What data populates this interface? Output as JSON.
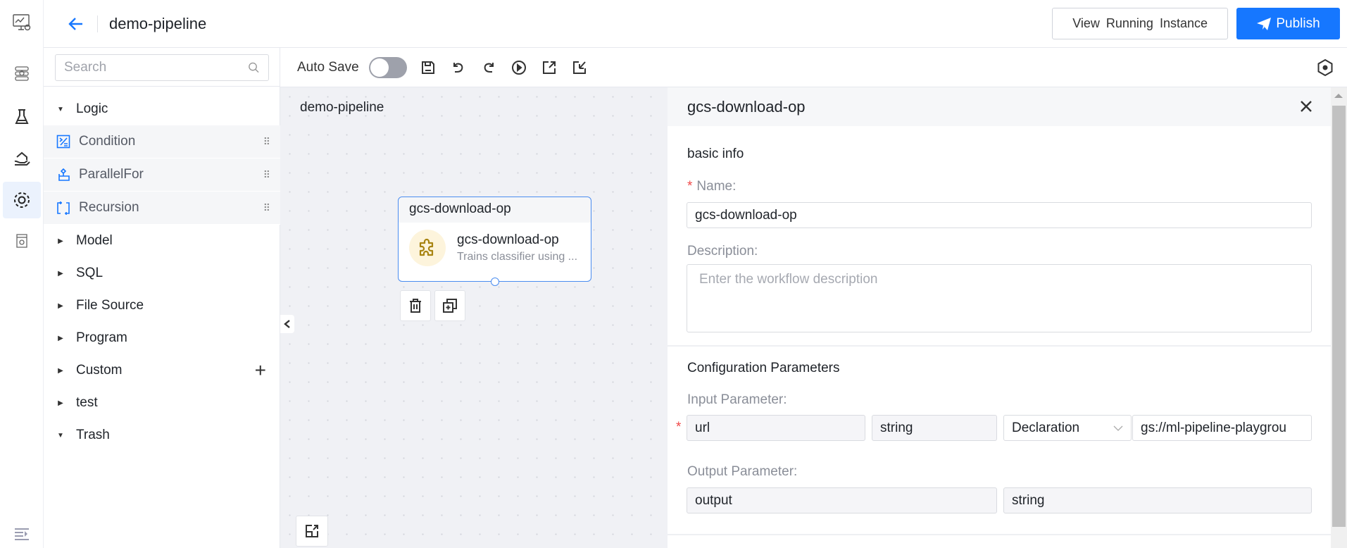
{
  "header": {
    "title": "demo-pipeline",
    "view_running_label": "View Running Instance",
    "publish_label": "Publish"
  },
  "rail": {
    "items": [
      {
        "icon": "monitor-chart-gear-icon",
        "active": false
      },
      {
        "icon": "server-gear-icon",
        "active": false
      },
      {
        "icon": "flask-icon",
        "active": false
      },
      {
        "icon": "hand-house-icon",
        "active": false
      },
      {
        "icon": "pipeline-circle-icon",
        "active": true
      },
      {
        "icon": "box-gear-icon",
        "active": false
      }
    ],
    "bottom_icon": "expand-menu-icon"
  },
  "sidebar": {
    "search_placeholder": "Search",
    "groups": [
      {
        "label": "Logic",
        "expanded": true,
        "items": [
          {
            "label": "Condition",
            "icon": "condition-icon"
          },
          {
            "label": "ParallelFor",
            "icon": "parallel-for-icon"
          },
          {
            "label": "Recursion",
            "icon": "recursion-icon"
          }
        ]
      },
      {
        "label": "Model",
        "expanded": false
      },
      {
        "label": "SQL",
        "expanded": false
      },
      {
        "label": "File Source",
        "expanded": false
      },
      {
        "label": "Program",
        "expanded": false
      },
      {
        "label": "Custom",
        "expanded": false,
        "has_add": true
      },
      {
        "label": "test",
        "expanded": false
      },
      {
        "label": "Trash",
        "expanded": true
      }
    ]
  },
  "toolbar": {
    "auto_save_label": "Auto Save",
    "auto_save_on": false,
    "icons": [
      "save-icon",
      "undo-icon",
      "redo-icon",
      "run-icon",
      "export-icon",
      "import-icon"
    ],
    "right_icon": "settings-hexagon-icon"
  },
  "canvas": {
    "title": "demo-pipeline",
    "node": {
      "header": "gcs-download-op",
      "name": "gcs-download-op",
      "description": "Trains classifier using ..."
    }
  },
  "panel": {
    "title": "gcs-download-op",
    "basic_info_title": "basic info",
    "name_label": "Name:",
    "name_value": "gcs-download-op",
    "description_label": "Description:",
    "description_placeholder": "Enter the workflow description",
    "config_title": "Configuration Parameters",
    "input_label": "Input Parameter:",
    "input": {
      "name": "url",
      "type": "string",
      "mode": "Declaration",
      "value": "gs://ml-pipeline-playgrou"
    },
    "output_label": "Output Parameter:",
    "output": {
      "name": "output",
      "type": "string"
    }
  },
  "colors": {
    "primary": "#1677ff",
    "required": "#f04848",
    "node_border": "#4a8cf0",
    "node_icon_bg": "#fdf4dc",
    "node_icon": "#a88412"
  }
}
